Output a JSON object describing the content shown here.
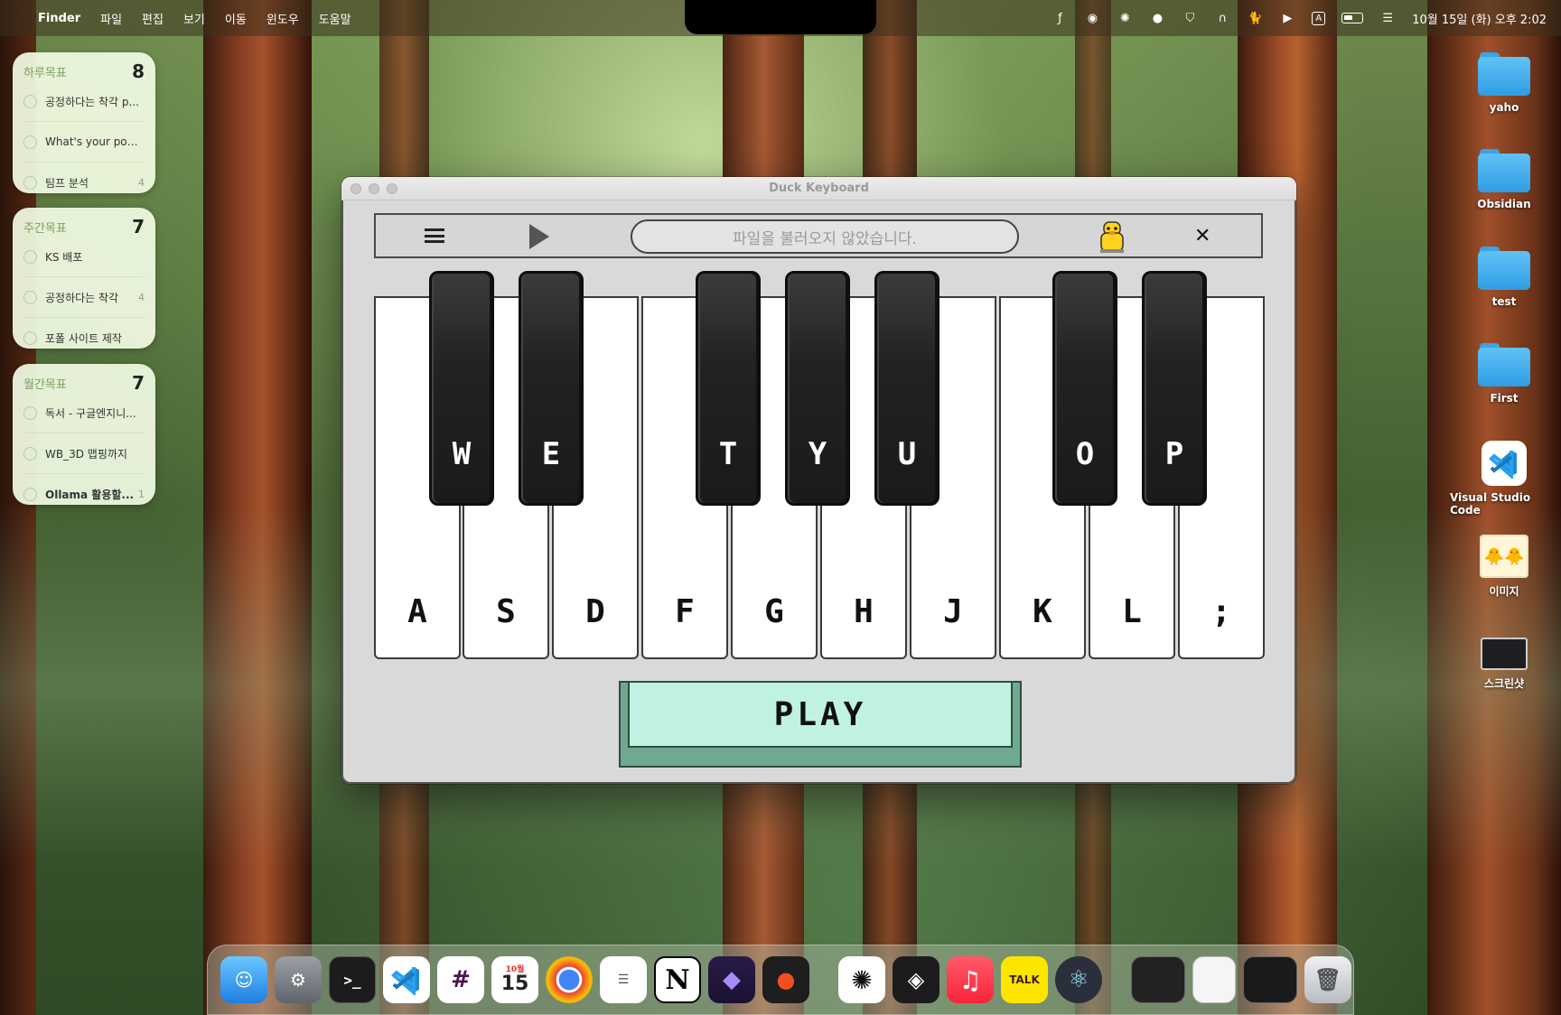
{
  "menubar": {
    "app_name": "Finder",
    "menus": [
      "파일",
      "편집",
      "보기",
      "이동",
      "윈도우",
      "도움말"
    ],
    "clock": "10월 15일 (화) 오후 2:02",
    "ime": "A"
  },
  "widgets": [
    {
      "title": "하루목표",
      "count": "8",
      "items": [
        {
          "text": "공정하다는 착각 p...",
          "num": ""
        },
        {
          "text": "What's your posi...",
          "num": ""
        },
        {
          "text": "팀프 분석",
          "num": "4"
        }
      ]
    },
    {
      "title": "주간목표",
      "count": "7",
      "items": [
        {
          "text": "KS 배포",
          "num": ""
        },
        {
          "text": "공정하다는 착각",
          "num": "4"
        },
        {
          "text": "포폴 사이트 제작",
          "num": ""
        }
      ]
    },
    {
      "title": "월간목표",
      "count": "7",
      "items": [
        {
          "text": "독서 - 구글엔지니...",
          "num": ""
        },
        {
          "text": "WB_3D 맵핑까지",
          "num": ""
        },
        {
          "text": "Ollama 활용할...",
          "num": "1"
        }
      ]
    }
  ],
  "desktop_icons": [
    "yaho",
    "Obsidian",
    "test",
    "First",
    "Visual Studio Code",
    "이미지",
    "스크린샷"
  ],
  "window": {
    "title": "Duck Keyboard",
    "file_status": "파일을 불러오지 않았습니다.",
    "play_label": "PLAY"
  },
  "piano": {
    "white_keys": [
      "A",
      "S",
      "D",
      "F",
      "G",
      "H",
      "J",
      "K",
      "L",
      ";"
    ],
    "black_keys": [
      "W",
      "E",
      "T",
      "Y",
      "U",
      "O",
      "P"
    ]
  },
  "dock": {
    "calendar_month": "10월",
    "calendar_day": "15",
    "kakao_label": "TALK"
  },
  "colors": {
    "play_face": "#bff2e1",
    "play_base": "#6fa98f",
    "folder": "#3fb0ee",
    "widget_bg": "#f2fce4"
  }
}
